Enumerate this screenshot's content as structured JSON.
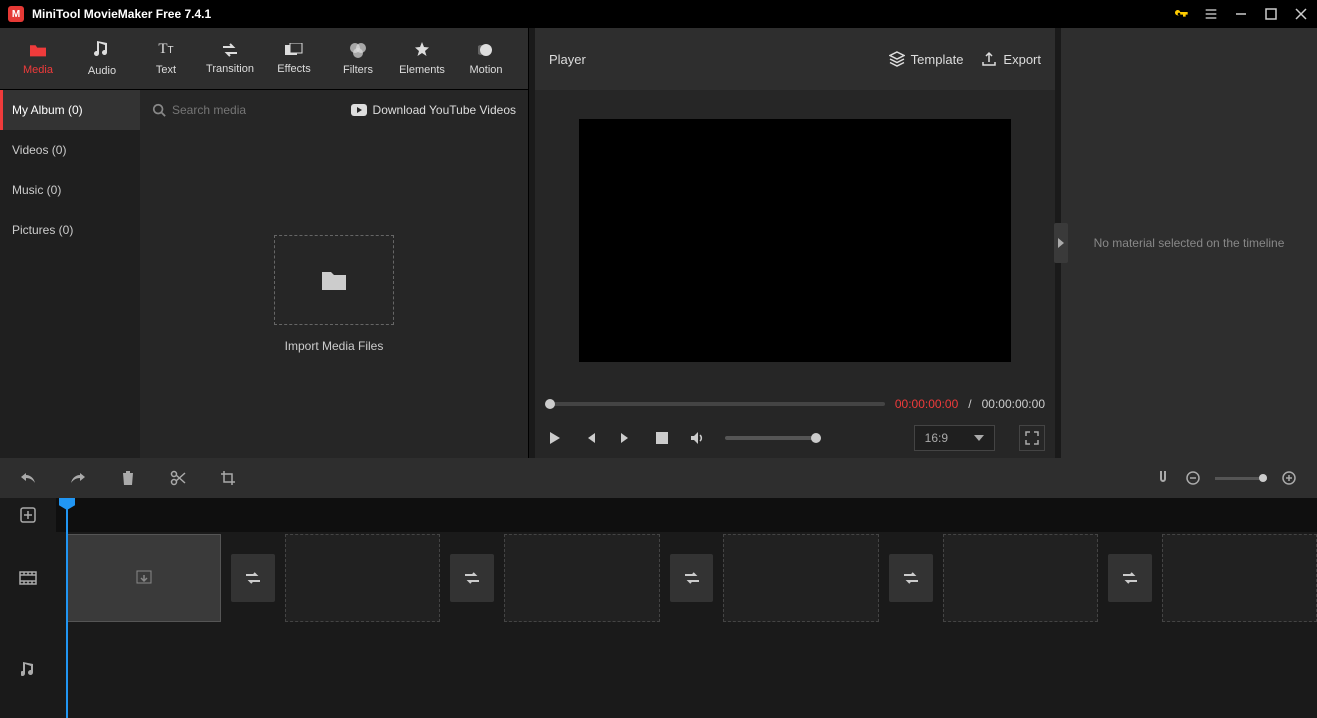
{
  "titlebar": {
    "title": "MiniTool MovieMaker Free 7.4.1"
  },
  "toolbar": [
    {
      "label": "Media",
      "active": true
    },
    {
      "label": "Audio",
      "active": false
    },
    {
      "label": "Text",
      "active": false
    },
    {
      "label": "Transition",
      "active": false
    },
    {
      "label": "Effects",
      "active": false
    },
    {
      "label": "Filters",
      "active": false
    },
    {
      "label": "Elements",
      "active": false
    },
    {
      "label": "Motion",
      "active": false
    }
  ],
  "mediaSide": [
    {
      "label": "My Album (0)",
      "active": true
    },
    {
      "label": "Videos (0)",
      "active": false
    },
    {
      "label": "Music (0)",
      "active": false
    },
    {
      "label": "Pictures (0)",
      "active": false
    }
  ],
  "search": {
    "placeholder": "Search media"
  },
  "ytlink": "Download YouTube Videos",
  "importLabel": "Import Media Files",
  "player": {
    "title": "Player",
    "templateLabel": "Template",
    "exportLabel": "Export",
    "current": "00:00:00:00",
    "sep": " / ",
    "total": "00:00:00:00",
    "ratio": "16:9"
  },
  "inspector": {
    "empty": "No material selected on the timeline"
  }
}
